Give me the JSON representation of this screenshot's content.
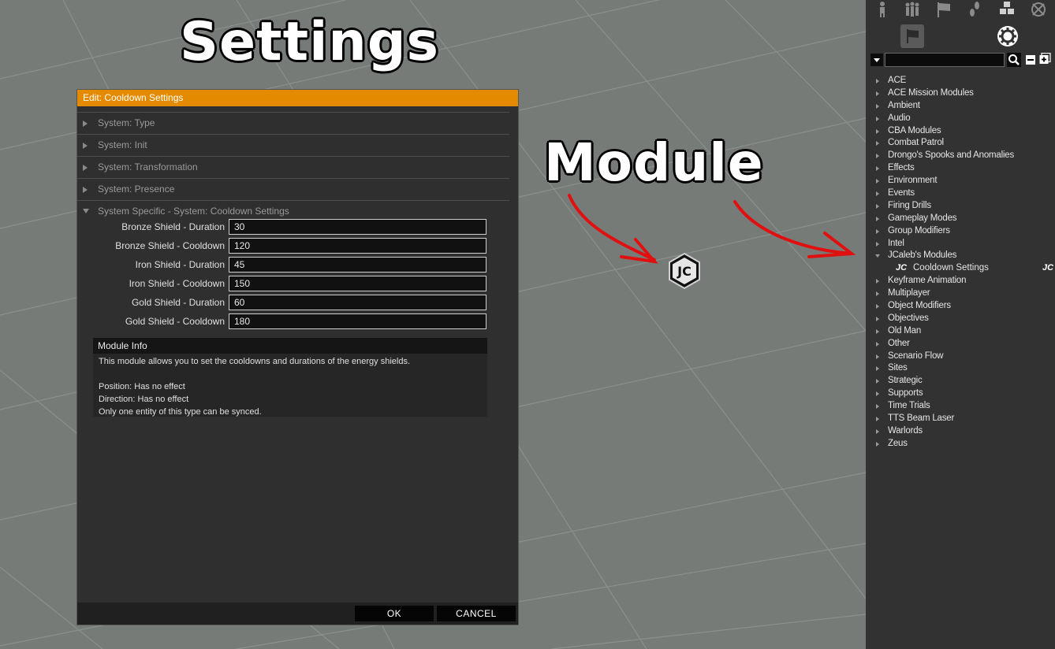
{
  "annotations": {
    "settings_label": "Settings",
    "module_label": "Module"
  },
  "dialog": {
    "title": "Edit: Cooldown Settings",
    "sections": [
      {
        "label": "System: Type",
        "open": false
      },
      {
        "label": "System: Init",
        "open": false
      },
      {
        "label": "System: Transformation",
        "open": false
      },
      {
        "label": "System: Presence",
        "open": false
      },
      {
        "label": "System Specific - System: Cooldown Settings",
        "open": true
      }
    ],
    "attributes": [
      {
        "label": "Bronze Shield - Duration",
        "value": "30"
      },
      {
        "label": "Bronze Shield - Cooldown",
        "value": "120"
      },
      {
        "label": "Iron Shield - Duration",
        "value": "45"
      },
      {
        "label": "Iron Shield - Cooldown",
        "value": "150"
      },
      {
        "label": "Gold Shield - Duration",
        "value": "60"
      },
      {
        "label": "Gold Shield - Cooldown",
        "value": "180"
      }
    ],
    "module_info": {
      "header": "Module Info",
      "lines": [
        "This module allows you to set the cooldowns and durations of the energy shields.",
        "",
        "Position: Has no effect",
        "Direction: Has no effect",
        "Only one entity of this type can be synced."
      ]
    },
    "ok_label": "OK",
    "cancel_label": "CANCEL"
  },
  "viewport": {
    "module_marker_text": "JC"
  },
  "asset_panel": {
    "top_icons": [
      "unit-icon",
      "group-icon",
      "flag-icon",
      "waypoint-icon",
      "object-icon",
      "marker-icon"
    ],
    "mode_icons": [
      "flag-mode-icon",
      "gear-mode-icon"
    ],
    "search_placeholder": "",
    "tree": [
      {
        "label": "ACE"
      },
      {
        "label": "ACE Mission Modules"
      },
      {
        "label": "Ambient"
      },
      {
        "label": "Audio"
      },
      {
        "label": "CBA Modules"
      },
      {
        "label": "Combat Patrol"
      },
      {
        "label": "Drongo's Spooks and Anomalies"
      },
      {
        "label": "Effects"
      },
      {
        "label": "Environment"
      },
      {
        "label": "Events"
      },
      {
        "label": "Firing Drills"
      },
      {
        "label": "Gameplay Modes"
      },
      {
        "label": "Group Modifiers"
      },
      {
        "label": "Intel"
      },
      {
        "label": "JCaleb's Modules",
        "open": true,
        "children": [
          {
            "label": "Cooldown Settings",
            "icon": "JC"
          }
        ]
      },
      {
        "label": "Keyframe Animation"
      },
      {
        "label": "Multiplayer"
      },
      {
        "label": "Object Modifiers"
      },
      {
        "label": "Objectives"
      },
      {
        "label": "Old Man"
      },
      {
        "label": "Other"
      },
      {
        "label": "Scenario Flow"
      },
      {
        "label": "Sites"
      },
      {
        "label": "Strategic"
      },
      {
        "label": "Supports"
      },
      {
        "label": "Time Trials"
      },
      {
        "label": "TTS Beam Laser"
      },
      {
        "label": "Warlords"
      },
      {
        "label": "Zeus"
      }
    ]
  },
  "colors": {
    "titlebar": "#e38a00",
    "arrow": "#e01010",
    "panel": "#323232",
    "ground": "#7a7e7a"
  }
}
